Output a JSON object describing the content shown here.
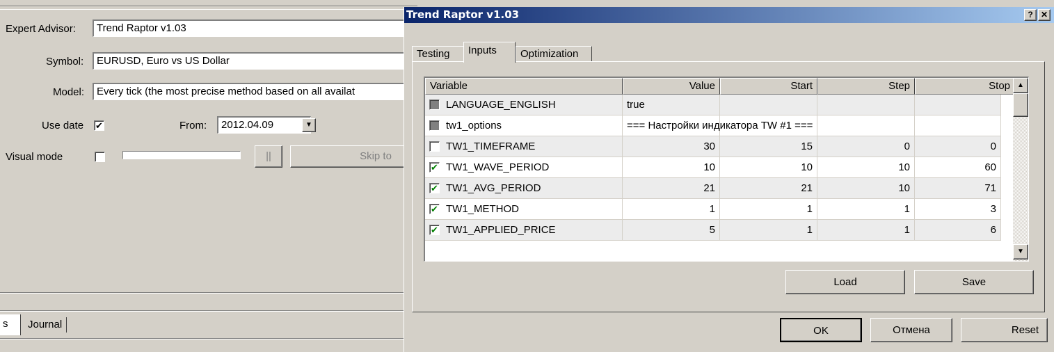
{
  "tester": {
    "expert_label": "Expert Advisor:",
    "expert_value": "Trend Raptor v1.03",
    "symbol_label": "Symbol:",
    "symbol_value": "EURUSD, Euro vs US Dollar",
    "model_label": "Model:",
    "model_value": "Every tick (the most precise method based on all availat",
    "use_date_label": "Use date",
    "use_date_checked": "✔",
    "from_label": "From:",
    "from_value": "2012.04.09",
    "visual_label": "Visual mode",
    "pause_label": "||",
    "skip_label": "Skip to",
    "tab_partial": "s",
    "tab_journal": "Journal"
  },
  "dialog": {
    "title": "Trend Raptor v1.03",
    "help_label": "?",
    "close_label": "✕",
    "tabs": [
      "Testing",
      "Inputs",
      "Optimization"
    ],
    "active_tab": "Inputs",
    "columns": [
      "Variable",
      "Value",
      "Start",
      "Step",
      "Stop"
    ],
    "rows": [
      {
        "name": "LANGUAGE_ENGLISH",
        "value": "true",
        "start": "",
        "step": "",
        "stop": "",
        "check": "gray"
      },
      {
        "name": "tw1_options",
        "value": "=== Настройки индикатора TW #1 ===",
        "start": "",
        "step": "",
        "stop": "",
        "check": "gray"
      },
      {
        "name": "TW1_TIMEFRAME",
        "value": "30",
        "start": "15",
        "step": "0",
        "stop": "0",
        "check": "empty"
      },
      {
        "name": "TW1_WAVE_PERIOD",
        "value": "10",
        "start": "10",
        "step": "10",
        "stop": "60",
        "check": "checked"
      },
      {
        "name": "TW1_AVG_PERIOD",
        "value": "21",
        "start": "21",
        "step": "10",
        "stop": "71",
        "check": "checked"
      },
      {
        "name": "TW1_METHOD",
        "value": "1",
        "start": "1",
        "step": "1",
        "stop": "3",
        "check": "checked"
      },
      {
        "name": "TW1_APPLIED_PRICE",
        "value": "5",
        "start": "1",
        "step": "1",
        "stop": "6",
        "check": "checked"
      }
    ],
    "load_label": "Load",
    "save_label": "Save",
    "ok_label": "OK",
    "cancel_label": "Отмена",
    "reset_label": "Reset"
  },
  "icons": {
    "checkmark": "check-icon",
    "dropdown": "chevron-down-icon",
    "scroll_up": "arrow-up-icon",
    "scroll_down": "arrow-down-icon"
  },
  "colors": {
    "title_start": "#0a246a",
    "title_end": "#a6caf0",
    "face": "#d4d0c8",
    "check_green": "#008000"
  }
}
